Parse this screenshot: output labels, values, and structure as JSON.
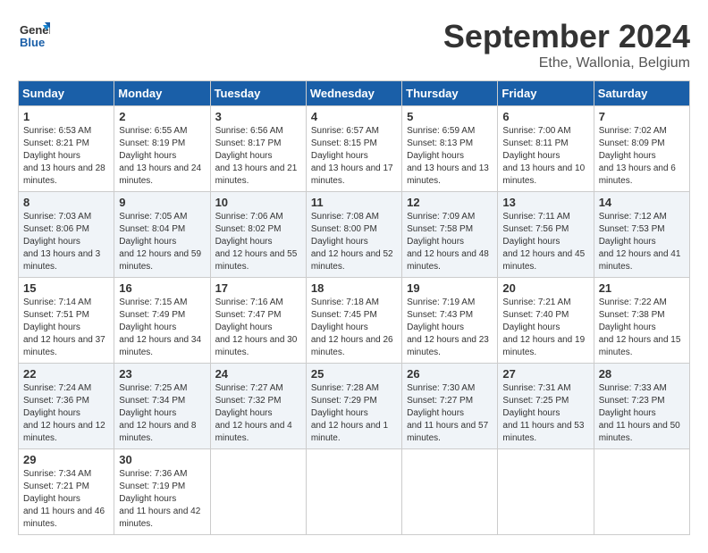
{
  "logo": {
    "line1": "General",
    "line2": "Blue"
  },
  "header": {
    "month": "September 2024",
    "location": "Ethe, Wallonia, Belgium"
  },
  "weekdays": [
    "Sunday",
    "Monday",
    "Tuesday",
    "Wednesday",
    "Thursday",
    "Friday",
    "Saturday"
  ],
  "weeks": [
    [
      {
        "day": "1",
        "rise": "6:53 AM",
        "set": "8:21 PM",
        "daylight": "13 hours and 28 minutes."
      },
      {
        "day": "2",
        "rise": "6:55 AM",
        "set": "8:19 PM",
        "daylight": "13 hours and 24 minutes."
      },
      {
        "day": "3",
        "rise": "6:56 AM",
        "set": "8:17 PM",
        "daylight": "13 hours and 21 minutes."
      },
      {
        "day": "4",
        "rise": "6:57 AM",
        "set": "8:15 PM",
        "daylight": "13 hours and 17 minutes."
      },
      {
        "day": "5",
        "rise": "6:59 AM",
        "set": "8:13 PM",
        "daylight": "13 hours and 13 minutes."
      },
      {
        "day": "6",
        "rise": "7:00 AM",
        "set": "8:11 PM",
        "daylight": "13 hours and 10 minutes."
      },
      {
        "day": "7",
        "rise": "7:02 AM",
        "set": "8:09 PM",
        "daylight": "13 hours and 6 minutes."
      }
    ],
    [
      {
        "day": "8",
        "rise": "7:03 AM",
        "set": "8:06 PM",
        "daylight": "13 hours and 3 minutes."
      },
      {
        "day": "9",
        "rise": "7:05 AM",
        "set": "8:04 PM",
        "daylight": "12 hours and 59 minutes."
      },
      {
        "day": "10",
        "rise": "7:06 AM",
        "set": "8:02 PM",
        "daylight": "12 hours and 55 minutes."
      },
      {
        "day": "11",
        "rise": "7:08 AM",
        "set": "8:00 PM",
        "daylight": "12 hours and 52 minutes."
      },
      {
        "day": "12",
        "rise": "7:09 AM",
        "set": "7:58 PM",
        "daylight": "12 hours and 48 minutes."
      },
      {
        "day": "13",
        "rise": "7:11 AM",
        "set": "7:56 PM",
        "daylight": "12 hours and 45 minutes."
      },
      {
        "day": "14",
        "rise": "7:12 AM",
        "set": "7:53 PM",
        "daylight": "12 hours and 41 minutes."
      }
    ],
    [
      {
        "day": "15",
        "rise": "7:14 AM",
        "set": "7:51 PM",
        "daylight": "12 hours and 37 minutes."
      },
      {
        "day": "16",
        "rise": "7:15 AM",
        "set": "7:49 PM",
        "daylight": "12 hours and 34 minutes."
      },
      {
        "day": "17",
        "rise": "7:16 AM",
        "set": "7:47 PM",
        "daylight": "12 hours and 30 minutes."
      },
      {
        "day": "18",
        "rise": "7:18 AM",
        "set": "7:45 PM",
        "daylight": "12 hours and 26 minutes."
      },
      {
        "day": "19",
        "rise": "7:19 AM",
        "set": "7:43 PM",
        "daylight": "12 hours and 23 minutes."
      },
      {
        "day": "20",
        "rise": "7:21 AM",
        "set": "7:40 PM",
        "daylight": "12 hours and 19 minutes."
      },
      {
        "day": "21",
        "rise": "7:22 AM",
        "set": "7:38 PM",
        "daylight": "12 hours and 15 minutes."
      }
    ],
    [
      {
        "day": "22",
        "rise": "7:24 AM",
        "set": "7:36 PM",
        "daylight": "12 hours and 12 minutes."
      },
      {
        "day": "23",
        "rise": "7:25 AM",
        "set": "7:34 PM",
        "daylight": "12 hours and 8 minutes."
      },
      {
        "day": "24",
        "rise": "7:27 AM",
        "set": "7:32 PM",
        "daylight": "12 hours and 4 minutes."
      },
      {
        "day": "25",
        "rise": "7:28 AM",
        "set": "7:29 PM",
        "daylight": "12 hours and 1 minute."
      },
      {
        "day": "26",
        "rise": "7:30 AM",
        "set": "7:27 PM",
        "daylight": "11 hours and 57 minutes."
      },
      {
        "day": "27",
        "rise": "7:31 AM",
        "set": "7:25 PM",
        "daylight": "11 hours and 53 minutes."
      },
      {
        "day": "28",
        "rise": "7:33 AM",
        "set": "7:23 PM",
        "daylight": "11 hours and 50 minutes."
      }
    ],
    [
      {
        "day": "29",
        "rise": "7:34 AM",
        "set": "7:21 PM",
        "daylight": "11 hours and 46 minutes."
      },
      {
        "day": "30",
        "rise": "7:36 AM",
        "set": "7:19 PM",
        "daylight": "11 hours and 42 minutes."
      },
      null,
      null,
      null,
      null,
      null
    ]
  ]
}
